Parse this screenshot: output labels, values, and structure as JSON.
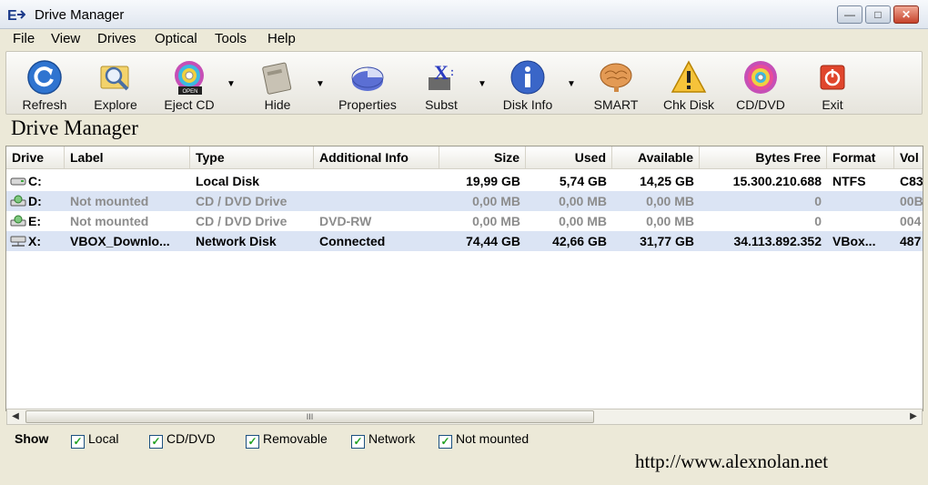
{
  "window": {
    "title": "Drive Manager",
    "minimize": "—",
    "maximize": "□",
    "close": "✕"
  },
  "menu": [
    "File",
    "View",
    "Drives",
    "Optical",
    "Tools",
    "Help"
  ],
  "toolbar": [
    {
      "label": "Refresh",
      "icon": "refresh-icon"
    },
    {
      "label": "Explore",
      "icon": "explore-icon"
    },
    {
      "label": "Eject CD",
      "icon": "eject-cd-icon"
    },
    {
      "label": "Hide",
      "icon": "hide-icon"
    },
    {
      "label": "Properties",
      "icon": "properties-icon"
    },
    {
      "label": "Subst",
      "icon": "subst-icon"
    },
    {
      "label": "Disk Info",
      "icon": "info-icon"
    },
    {
      "label": "SMART",
      "icon": "brain-icon"
    },
    {
      "label": "Chk Disk",
      "icon": "warning-icon"
    },
    {
      "label": "CD/DVD",
      "icon": "cd-dvd-icon"
    },
    {
      "label": "Exit",
      "icon": "exit-icon"
    }
  ],
  "eject_badge": "OPEN",
  "header_title": "Drive Manager",
  "columns": [
    "Drive",
    "Label",
    "Type",
    "Additional Info",
    "Size",
    "Used",
    "Available",
    "Bytes Free",
    "Format",
    "Vol"
  ],
  "rows": [
    {
      "drive": "C:",
      "label": "",
      "type": "Local Disk",
      "info": "",
      "size": "19,99 GB",
      "used": "5,74 GB",
      "available": "14,25 GB",
      "bytes_free": "15.300.210.688",
      "format": "NTFS",
      "vol": "C83",
      "icon": "hard-drive-icon"
    },
    {
      "drive": "D:",
      "label": "Not mounted",
      "type": "CD / DVD Drive",
      "info": "",
      "size": "0,00 MB",
      "used": "0,00 MB",
      "available": "0,00 MB",
      "bytes_free": "0",
      "format": "",
      "vol": "00B",
      "icon": "cd-drive-icon"
    },
    {
      "drive": "E:",
      "label": "Not mounted",
      "type": "CD / DVD Drive",
      "info": "DVD-RW",
      "size": "0,00 MB",
      "used": "0,00 MB",
      "available": "0,00 MB",
      "bytes_free": "0",
      "format": "",
      "vol": "004",
      "icon": "cd-drive-icon"
    },
    {
      "drive": "X:",
      "label": "VBOX_Downlo...",
      "type": "Network Disk",
      "info": "Connected",
      "size": "74,44 GB",
      "used": "42,66 GB",
      "available": "31,77 GB",
      "bytes_free": "34.113.892.352",
      "format": "VBox...",
      "vol": "487",
      "icon": "network-drive-icon"
    }
  ],
  "scroll_grip": "III",
  "show": {
    "label": "Show",
    "options": [
      {
        "label": "Local",
        "checked": true
      },
      {
        "label": "CD/DVD",
        "checked": true
      },
      {
        "label": "Removable",
        "checked": true
      },
      {
        "label": "Network",
        "checked": true
      },
      {
        "label": "Not mounted",
        "checked": true
      }
    ]
  },
  "url": "http://www.alexnolan.net"
}
